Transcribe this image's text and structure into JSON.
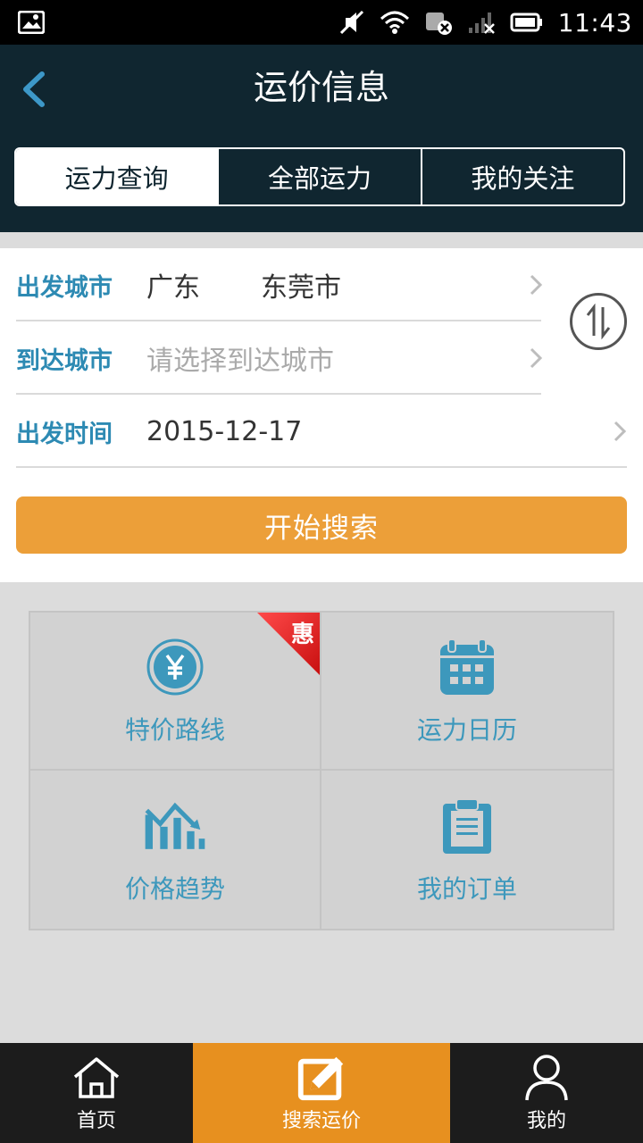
{
  "status_bar": {
    "time": "11:43"
  },
  "header": {
    "title": "运价信息"
  },
  "tabs": [
    {
      "label": "运力查询",
      "active": true
    },
    {
      "label": "全部运力",
      "active": false
    },
    {
      "label": "我的关注",
      "active": false
    }
  ],
  "form": {
    "departure": {
      "label": "出发城市",
      "province": "广东",
      "city": "东莞市"
    },
    "arrival": {
      "label": "到达城市",
      "placeholder": "请选择到达城市"
    },
    "time": {
      "label": "出发时间",
      "value": "2015-12-17"
    },
    "search_label": "开始搜索"
  },
  "grid": [
    {
      "label": "特价路线",
      "icon": "yen-icon",
      "badge": "惠"
    },
    {
      "label": "运力日历",
      "icon": "calendar-icon"
    },
    {
      "label": "价格趋势",
      "icon": "trend-icon"
    },
    {
      "label": "我的订单",
      "icon": "clipboard-icon"
    }
  ],
  "bottom_nav": [
    {
      "label": "首页",
      "icon": "home-icon"
    },
    {
      "label": "搜索运价",
      "icon": "edit-icon",
      "active": true
    },
    {
      "label": "我的",
      "icon": "user-icon"
    }
  ],
  "colors": {
    "header_bg": "#102630",
    "accent": "#ec9f39",
    "label_blue": "#2d8ab3",
    "nav_active": "#e7901f"
  }
}
